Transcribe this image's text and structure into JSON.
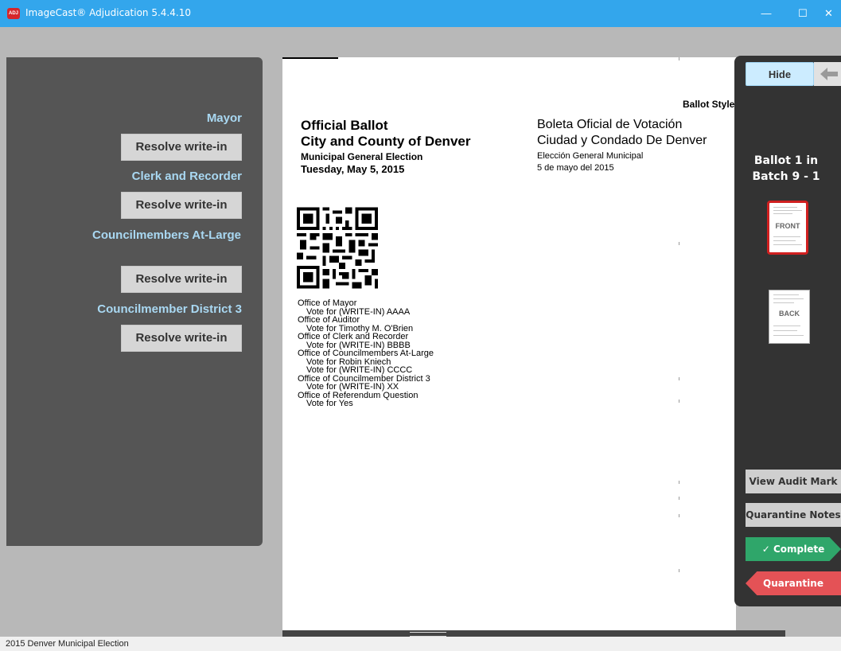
{
  "window": {
    "title": "ImageCast® Adjudication 5.4.4.10",
    "app_icon_text": "ADJ",
    "minimize_glyph": "—",
    "maximize_glyph": "☐",
    "close_glyph": "✕"
  },
  "contests": [
    {
      "title": "Mayor",
      "button": "Resolve write-in"
    },
    {
      "title": "Clerk and Recorder",
      "button": "Resolve write-in"
    },
    {
      "title": "Councilmembers At-Large",
      "button": "Resolve write-in"
    },
    {
      "title": "Councilmember District 3",
      "button": "Resolve write-in"
    }
  ],
  "ballot": {
    "style_label": "Ballot Style",
    "header_en": [
      "Official Ballot",
      "City and County of Denver",
      "Municipal General Election",
      "Tuesday, May 5, 2015"
    ],
    "header_es": [
      "Boleta Oficial de Votación",
      "Ciudad y Condado De Denver",
      "Elección General Municipal",
      "5 de mayo del 2015"
    ],
    "votes": [
      {
        "office": "Office of Mayor",
        "votes": [
          "Vote for (WRITE-IN) AAAA"
        ]
      },
      {
        "office": "Office of Auditor",
        "votes": [
          "Vote for Timothy M. O'Brien"
        ]
      },
      {
        "office": "Office of Clerk and Recorder",
        "votes": [
          "Vote for (WRITE-IN) BBBB"
        ]
      },
      {
        "office": "Office of Councilmembers At-Large",
        "votes": [
          "Vote for Robin Kniech",
          "Vote for (WRITE-IN) CCCC"
        ]
      },
      {
        "office": "Office of Councilmember District 3",
        "votes": [
          "Vote for (WRITE-IN) XX"
        ]
      },
      {
        "office": "Office of Referendum Question",
        "votes": [
          "Vote for Yes"
        ]
      }
    ]
  },
  "side_panel": {
    "hide_label": "Hide",
    "arrow_icon": "arrow-left-icon",
    "ballot_line1": "Ballot 1 in",
    "ballot_line2": "Batch 9 - 1",
    "front_label": "FRONT",
    "back_label": "BACK",
    "view_audit_mark": "View Audit Mark",
    "quarantine_notes": "Quarantine Notes",
    "complete": "✓  Complete",
    "quarantine": "Quarantine"
  },
  "status_bar": {
    "text": "2015 Denver Municipal Election"
  },
  "colors": {
    "titlebar": "#33a6ec",
    "contest_title": "#a9d8f2",
    "complete": "#2fa66a",
    "quarantine": "#e45256",
    "front_highlight": "#d02020"
  }
}
